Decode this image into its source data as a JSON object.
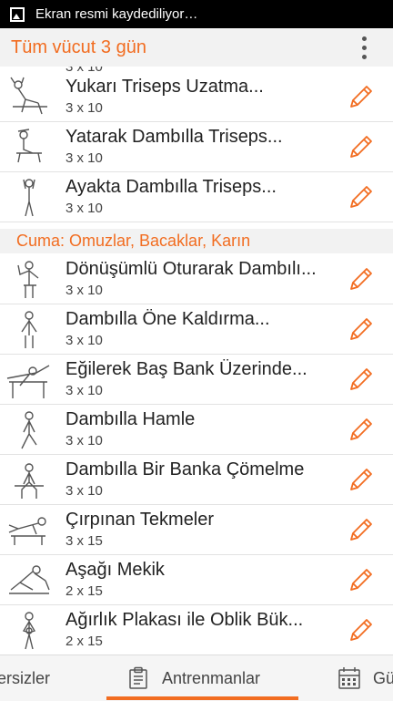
{
  "status_bar": {
    "text": "Ekran resmi kaydediliyor…"
  },
  "app_bar": {
    "title": "Tüm vücut 3 gün"
  },
  "list": {
    "partial_top_sets": "3 x 10",
    "items_before": [
      {
        "name": "Yukarı Triseps Uzatma...",
        "sets": "3 x 10"
      },
      {
        "name": "Yatarak Dambılla Triseps...",
        "sets": "3 x 10"
      },
      {
        "name": "Ayakta Dambılla Triseps...",
        "sets": "3 x 10"
      }
    ],
    "section_title": "Cuma: Omuzlar, Bacaklar, Karın",
    "items_after": [
      {
        "name": "Dönüşümlü Oturarak Dambılı...",
        "sets": "3 x 10"
      },
      {
        "name": "Dambılla Öne Kaldırma...",
        "sets": "3 x 10"
      },
      {
        "name": "Eğilerek Baş Bank Üzerinde...",
        "sets": "3 x 10"
      },
      {
        "name": "Dambılla Hamle",
        "sets": "3 x 10"
      },
      {
        "name": "Dambılla Bir Banka Çömelme",
        "sets": "3 x 10"
      },
      {
        "name": "Çırpınan Tekmeler",
        "sets": "3 x 15"
      },
      {
        "name": "Aşağı Mekik",
        "sets": "2 x 15"
      },
      {
        "name": "Ağırlık Plakası ile Oblik Bük...",
        "sets": "2 x 15"
      }
    ]
  },
  "bottom_nav": {
    "left_label": "ersizler",
    "center_label": "Antrenmanlar",
    "right_label": "Gü"
  },
  "colors": {
    "accent": "#f26d21",
    "divider": "#e2e2e2",
    "section_bg": "#f2f2f2"
  }
}
